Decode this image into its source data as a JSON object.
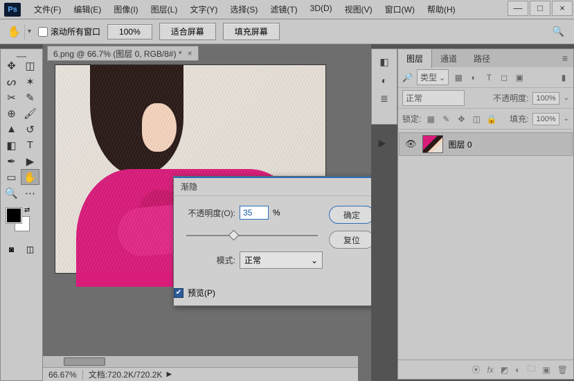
{
  "app": {
    "logo_text": "Ps"
  },
  "menu": {
    "items": [
      "文件(F)",
      "编辑(E)",
      "图像(I)",
      "图层(L)",
      "文字(Y)",
      "选择(S)",
      "滤镜(T)",
      "3D(D)",
      "视图(V)",
      "窗口(W)",
      "帮助(H)"
    ]
  },
  "window_buttons": {
    "min": "—",
    "max": "□",
    "close": "×"
  },
  "options_bar": {
    "scroll_all": "滚动所有窗口",
    "zoom": "100%",
    "fit": "适合屏幕",
    "fill": "填充屏幕"
  },
  "document": {
    "tab": "6.png @ 66.7% (图层 0, RGB/8#) *"
  },
  "status": {
    "zoom": "66.67%",
    "doc": "文档:720.2K/720.2K"
  },
  "panels": {
    "tabs": [
      "图层",
      "通道",
      "路径"
    ],
    "filter_label": "类型",
    "blend_mode": "正常",
    "opacity_label": "不透明度:",
    "opacity_value": "100%",
    "lock_label": "锁定:",
    "fill_label": "填充:",
    "fill_value": "100%",
    "layer0": "图层 0"
  },
  "dialog": {
    "title": "渐隐",
    "opacity_label": "不透明度(O):",
    "opacity_value": "35",
    "percent": "%",
    "mode_label": "模式:",
    "mode_value": "正常",
    "ok": "确定",
    "reset": "复位",
    "preview": "预览(P)"
  }
}
